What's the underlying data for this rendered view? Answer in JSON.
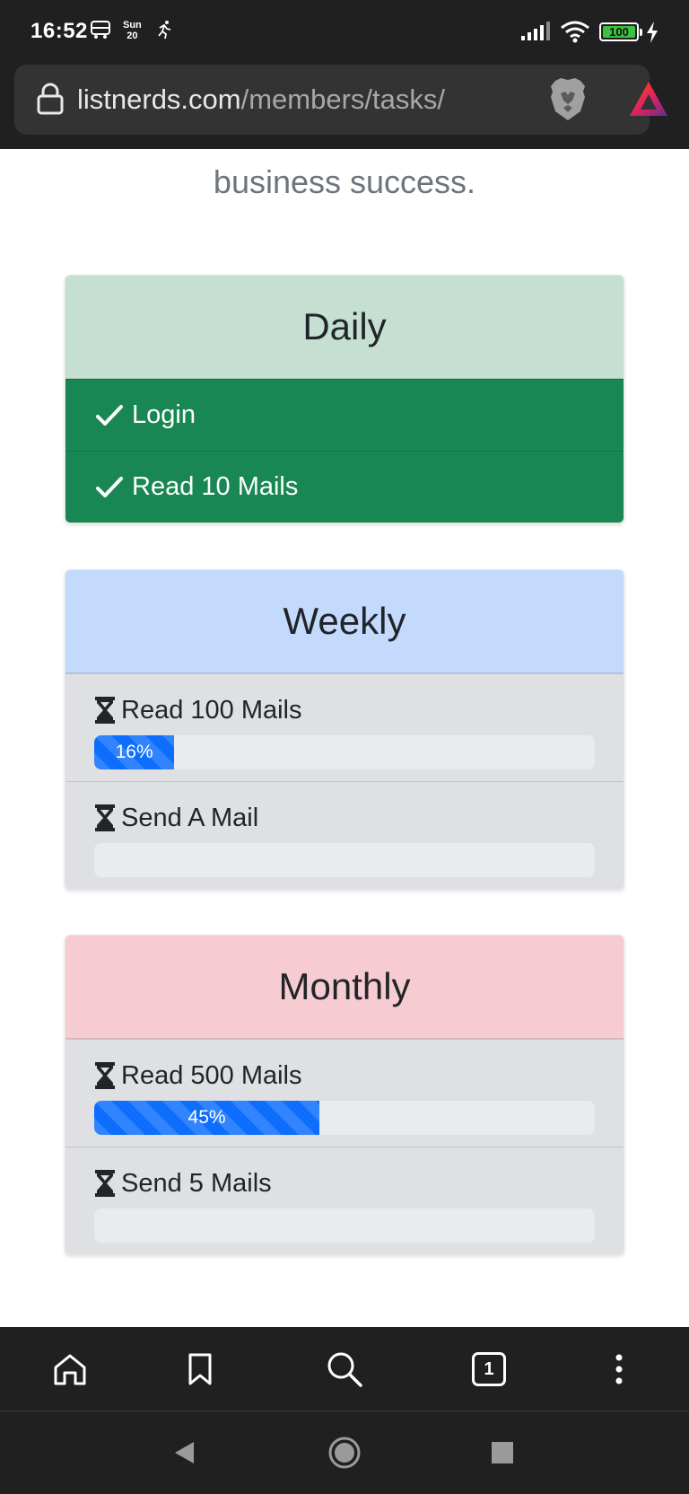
{
  "status_bar": {
    "time": "16:52",
    "date_day": "Sun",
    "date_num": "20",
    "battery": "100"
  },
  "browser": {
    "url_domain": "listnerds.com",
    "url_path": "/members/tasks/",
    "tab_count": "1"
  },
  "hero": {
    "visible_line": "business success."
  },
  "cards": {
    "daily": {
      "title": "Daily",
      "items": [
        {
          "label": "Login"
        },
        {
          "label": "Read 10 Mails"
        }
      ]
    },
    "weekly": {
      "title": "Weekly",
      "items": [
        {
          "label": "Read 100 Mails",
          "progress": 16,
          "progress_text": "16%"
        },
        {
          "label": "Send A Mail",
          "progress": 0,
          "progress_text": ""
        }
      ]
    },
    "monthly": {
      "title": "Monthly",
      "items": [
        {
          "label": "Read 500 Mails",
          "progress": 45,
          "progress_text": "45%"
        },
        {
          "label": "Send 5 Mails",
          "progress": 0,
          "progress_text": ""
        }
      ]
    }
  },
  "colors": {
    "daily_header": "#c5e0d3",
    "daily_done": "#198754",
    "weekly_header": "#c3dafc",
    "monthly_header": "#f6ccd2",
    "progress_fill": "#0d6efd"
  }
}
